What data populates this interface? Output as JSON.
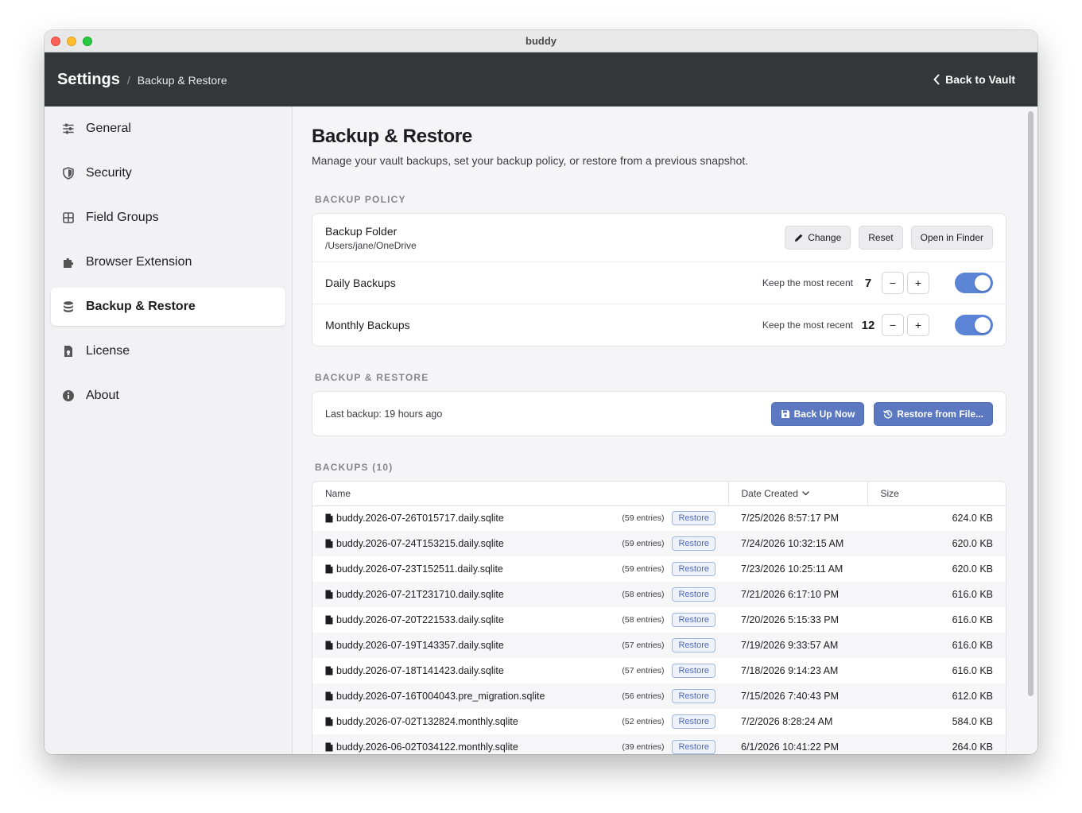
{
  "window": {
    "title": "buddy"
  },
  "header": {
    "root": "Settings",
    "separator": "/",
    "current": "Backup & Restore",
    "back_label": "Back to Vault"
  },
  "sidebar": {
    "items": [
      {
        "label": "General",
        "icon": "sliders-icon"
      },
      {
        "label": "Security",
        "icon": "shield-icon"
      },
      {
        "label": "Field Groups",
        "icon": "grid-icon"
      },
      {
        "label": "Browser Extension",
        "icon": "puzzle-icon"
      },
      {
        "label": "Backup & Restore",
        "icon": "database-icon",
        "active": true
      },
      {
        "label": "License",
        "icon": "license-icon"
      },
      {
        "label": "About",
        "icon": "info-icon"
      }
    ]
  },
  "page": {
    "title": "Backup & Restore",
    "description": "Manage your vault backups, set your backup policy, or restore from a previous snapshot."
  },
  "policy": {
    "section_label": "BACKUP POLICY",
    "folder": {
      "title": "Backup Folder",
      "path": "/Users/jane/OneDrive",
      "change_label": "Change",
      "reset_label": "Reset",
      "open_label": "Open in Finder"
    },
    "daily": {
      "title": "Daily Backups",
      "keep_label": "Keep the most recent",
      "count": "7",
      "enabled": true
    },
    "monthly": {
      "title": "Monthly Backups",
      "keep_label": "Keep the most recent",
      "count": "12",
      "enabled": true
    },
    "minus": "−",
    "plus": "+"
  },
  "restore": {
    "section_label": "BACKUP & RESTORE",
    "last_backup": "Last backup: 19 hours ago",
    "backup_now_label": "Back Up Now",
    "restore_file_label": "Restore from File..."
  },
  "backups": {
    "section_label": "BACKUPS (10)",
    "columns": {
      "name": "Name",
      "date": "Date Created",
      "size": "Size"
    },
    "restore_label": "Restore",
    "rows": [
      {
        "name": "buddy.2026-07-26T015717.daily.sqlite",
        "entries": "(59 entries)",
        "date": "7/25/2026 8:57:17 PM",
        "size": "624.0 KB"
      },
      {
        "name": "buddy.2026-07-24T153215.daily.sqlite",
        "entries": "(59 entries)",
        "date": "7/24/2026 10:32:15 AM",
        "size": "620.0 KB"
      },
      {
        "name": "buddy.2026-07-23T152511.daily.sqlite",
        "entries": "(59 entries)",
        "date": "7/23/2026 10:25:11 AM",
        "size": "620.0 KB"
      },
      {
        "name": "buddy.2026-07-21T231710.daily.sqlite",
        "entries": "(58 entries)",
        "date": "7/21/2026 6:17:10 PM",
        "size": "616.0 KB"
      },
      {
        "name": "buddy.2026-07-20T221533.daily.sqlite",
        "entries": "(58 entries)",
        "date": "7/20/2026 5:15:33 PM",
        "size": "616.0 KB"
      },
      {
        "name": "buddy.2026-07-19T143357.daily.sqlite",
        "entries": "(57 entries)",
        "date": "7/19/2026 9:33:57 AM",
        "size": "616.0 KB"
      },
      {
        "name": "buddy.2026-07-18T141423.daily.sqlite",
        "entries": "(57 entries)",
        "date": "7/18/2026 9:14:23 AM",
        "size": "616.0 KB"
      },
      {
        "name": "buddy.2026-07-16T004043.pre_migration.sqlite",
        "entries": "(56 entries)",
        "date": "7/15/2026 7:40:43 PM",
        "size": "612.0 KB"
      },
      {
        "name": "buddy.2026-07-02T132824.monthly.sqlite",
        "entries": "(52 entries)",
        "date": "7/2/2026 8:28:24 AM",
        "size": "584.0 KB"
      },
      {
        "name": "buddy.2026-06-02T034122.monthly.sqlite",
        "entries": "(39 entries)",
        "date": "6/1/2026 10:41:22 PM",
        "size": "264.0 KB"
      }
    ]
  },
  "colors": {
    "accent": "#5b78c0",
    "toggle_on": "#5b84d6",
    "header_bg": "#35363a"
  }
}
